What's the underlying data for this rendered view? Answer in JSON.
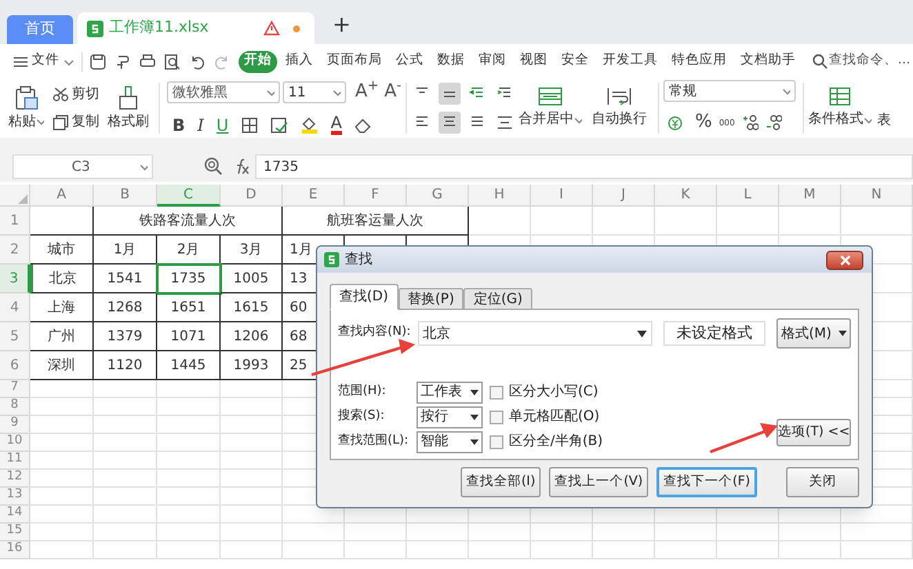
{
  "doc_tabs": [
    {
      "kind": "home",
      "label": "首页",
      "selected": false
    },
    {
      "kind": "file",
      "label": "工作簿11.xlsx",
      "selected": true
    }
  ],
  "new_tab": "+",
  "menu": {
    "file": "文件",
    "items": [
      {
        "label": "开始",
        "selected": true
      },
      {
        "label": "插入",
        "selected": false
      },
      {
        "label": "页面布局",
        "selected": false
      },
      {
        "label": "公式",
        "selected": false
      },
      {
        "label": "数据",
        "selected": false
      },
      {
        "label": "审阅",
        "selected": false
      },
      {
        "label": "视图",
        "selected": false
      },
      {
        "label": "安全",
        "selected": false
      },
      {
        "label": "开发工具",
        "selected": false
      },
      {
        "label": "特色应用",
        "selected": false
      },
      {
        "label": "文档助手",
        "selected": false
      }
    ],
    "search_placeholder": "查找命令、..."
  },
  "ribbon": {
    "paste": "粘贴",
    "cut": "剪切",
    "copy": "复制",
    "format_painter": "格式刷",
    "font": "微软雅黑",
    "font_size": "11",
    "grow": "A$^{+}$",
    "shrink": "A$^{-}$",
    "bold": "B",
    "italic": "I",
    "underline": "U",
    "font_color": "A",
    "merge": "合并居中",
    "wrap": "自动换行",
    "number_format": "常规",
    "percent": "%",
    "thousands": "000",
    "conditional": "条件格式",
    "table": "表"
  },
  "name_box": "C3",
  "formula": "1735",
  "columns": [
    {
      "label": "A",
      "selected": false
    },
    {
      "label": "B",
      "selected": false
    },
    {
      "label": "C",
      "selected": true
    },
    {
      "label": "D",
      "selected": false
    },
    {
      "label": "E",
      "selected": false
    },
    {
      "label": "F",
      "selected": false
    },
    {
      "label": "G",
      "selected": false
    },
    {
      "label": "H",
      "selected": false
    },
    {
      "label": "I",
      "selected": false
    },
    {
      "label": "J",
      "selected": false
    },
    {
      "label": "K",
      "selected": false
    },
    {
      "label": "L",
      "selected": false
    },
    {
      "label": "M",
      "selected": false
    },
    {
      "label": "N",
      "selected": false
    }
  ],
  "rows": [
    {
      "number": "1",
      "selected": false,
      "kind": "title",
      "groups": [
        "铁路客流量人次",
        "航班客运量人次"
      ]
    },
    {
      "number": "2",
      "selected": false,
      "kind": "data",
      "cells": [
        "城市",
        "1月",
        "2月",
        "3月",
        "1月"
      ]
    },
    {
      "number": "3",
      "selected": true,
      "kind": "data",
      "cells": [
        "北京",
        "1541",
        "1735",
        "1005",
        "13"
      ]
    },
    {
      "number": "4",
      "selected": false,
      "kind": "data",
      "cells": [
        "上海",
        "1268",
        "1651",
        "1615",
        "60"
      ]
    },
    {
      "number": "5",
      "selected": false,
      "kind": "data",
      "cells": [
        "广州",
        "1379",
        "1071",
        "1206",
        "68"
      ]
    },
    {
      "number": "6",
      "selected": false,
      "kind": "data",
      "cells": [
        "深圳",
        "1120",
        "1445",
        "1993",
        "25"
      ]
    },
    {
      "number": "7",
      "selected": false,
      "kind": "empty"
    },
    {
      "number": "8",
      "selected": false,
      "kind": "empty"
    },
    {
      "number": "9",
      "selected": false,
      "kind": "empty"
    },
    {
      "number": "10",
      "selected": false,
      "kind": "empty"
    },
    {
      "number": "11",
      "selected": false,
      "kind": "empty"
    },
    {
      "number": "12",
      "selected": false,
      "kind": "empty"
    },
    {
      "number": "13",
      "selected": false,
      "kind": "empty"
    },
    {
      "number": "14",
      "selected": false,
      "kind": "empty"
    },
    {
      "number": "15",
      "selected": false,
      "kind": "empty"
    },
    {
      "number": "16",
      "selected": false,
      "kind": "empty"
    }
  ],
  "dialog": {
    "title": "查找",
    "tabs": [
      {
        "label": "查找(D)",
        "selected": true
      },
      {
        "label": "替换(P)",
        "selected": false
      },
      {
        "label": "定位(G)",
        "selected": false
      }
    ],
    "find_label": "查找内容(N):",
    "find_value": "北京",
    "format_status": "未设定格式",
    "format_button": "格式(M)",
    "options": [
      {
        "label": "范围(H):",
        "value": "工作表",
        "checkbox": "区分大小写(C)",
        "checked": false
      },
      {
        "label": "搜索(S):",
        "value": "按行",
        "checkbox": "单元格匹配(O)",
        "checked": false
      },
      {
        "label": "查找范围(L):",
        "value": "智能",
        "checkbox": "区分全/半角(B)",
        "checked": false
      }
    ],
    "options_button": "选项(T) <<",
    "buttons": [
      {
        "label": "查找全部(I)",
        "focused": false
      },
      {
        "label": "查找上一个(V)",
        "focused": false
      },
      {
        "label": "查找下一个(F)",
        "focused": true
      },
      {
        "label": "关闭",
        "focused": false
      }
    ]
  }
}
